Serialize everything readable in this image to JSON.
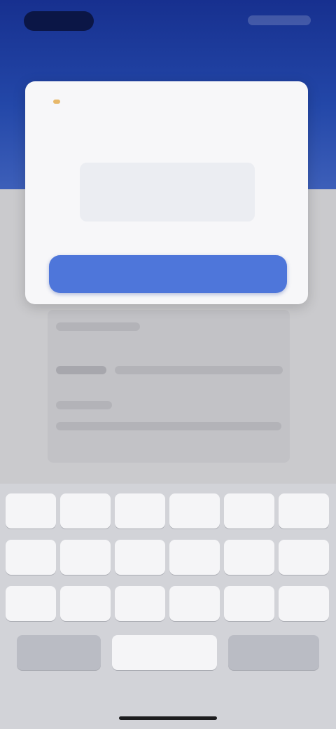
{
  "status_bar": {
    "time": ""
  },
  "dialog": {
    "title": "",
    "subtitle": "",
    "captcha_text": "",
    "confirm_label": ""
  },
  "keyboard": {
    "rows": [
      [
        {
          "name": "key-1",
          "label": ""
        },
        {
          "name": "key-2",
          "label": ""
        },
        {
          "name": "key-3",
          "label": ""
        },
        {
          "name": "key-4",
          "label": ""
        },
        {
          "name": "key-5",
          "label": ""
        },
        {
          "name": "key-6",
          "label": ""
        }
      ],
      [
        {
          "name": "key-7",
          "label": ""
        },
        {
          "name": "key-8",
          "label": ""
        },
        {
          "name": "key-9",
          "label": ""
        },
        {
          "name": "key-10",
          "label": ""
        },
        {
          "name": "key-11",
          "label": ""
        },
        {
          "name": "key-12",
          "label": ""
        }
      ],
      [
        {
          "name": "key-13",
          "label": ""
        },
        {
          "name": "key-14",
          "label": ""
        },
        {
          "name": "key-15",
          "label": ""
        },
        {
          "name": "key-16",
          "label": ""
        },
        {
          "name": "key-17",
          "label": ""
        },
        {
          "name": "key-18",
          "label": ""
        }
      ]
    ],
    "bottom": {
      "left_label": "",
      "space_label": "",
      "right_label": ""
    }
  },
  "colors": {
    "header": "#1f3fa0",
    "primary_button": "#4e76da",
    "card": "#f7f7f9",
    "keyboard": "#d2d3d8"
  }
}
